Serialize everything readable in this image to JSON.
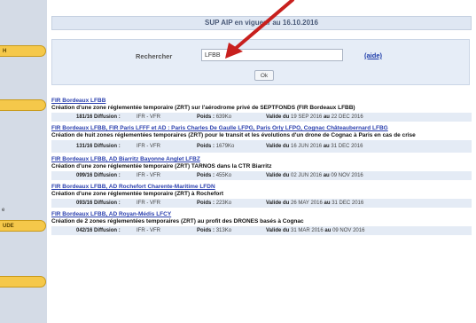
{
  "sidebar": {
    "buttons": [
      {
        "label": "H"
      },
      {
        "label": ""
      },
      {
        "label": "UDE"
      },
      {
        "label": ""
      }
    ],
    "text": "e"
  },
  "header": {
    "title": "SUP AIP en vigueur au 16.10.2016"
  },
  "search": {
    "label": "Rechercher",
    "value": "LFBB",
    "help": "(aide)",
    "ok": "Ok"
  },
  "entries": [
    {
      "title": "FIR Bordeaux LFBB",
      "desc": "Création d'une zone réglementée temporaire (ZRT) sur l'aérodrome privé de SEPTFONDS (FIR Bordeaux LFBB)",
      "number": "181/16",
      "diffusion_label": "Diffusion :",
      "diffusion": "IFR - VFR",
      "poids_label": "Poids :",
      "poids": "639Ko",
      "valid_label": "Valide du",
      "valid_from": "19 SEP 2016",
      "au": "au",
      "valid_to": "22 DEC 2016"
    },
    {
      "title": "FIR Bordeaux LFBB, FIR Paris LFFF et AD : Paris Charles De Gaulle LFPG, Paris Orly LFPO, Cognac Châteaubernard LFBG",
      "desc": "Création de huit zones réglementées temporaires (ZRT) pour le transit et les évolutions d'un drone de Cognac à Paris en cas de crise",
      "number": "131/16",
      "diffusion_label": "Diffusion :",
      "diffusion": "IFR - VFR",
      "poids_label": "Poids :",
      "poids": "1679Ko",
      "valid_label": "Valide du",
      "valid_from": "16 JUN 2016",
      "au": "au",
      "valid_to": "31 DEC 2016"
    },
    {
      "title": "FIR Bordeaux LFBB, AD Biarritz Bayonne Anglet LFBZ",
      "desc": "Création d'une zone réglementée temporaire (ZRT) TARNOS dans la CTR Biarritz",
      "number": "099/16",
      "diffusion_label": "Diffusion :",
      "diffusion": "IFR - VFR",
      "poids_label": "Poids :",
      "poids": "455Ko",
      "valid_label": "Valide du",
      "valid_from": "02 JUN 2016",
      "au": "au",
      "valid_to": "09 NOV 2016"
    },
    {
      "title": "FIR Bordeaux LFBB, AD Rochefort Charente-Maritime LFDN",
      "desc": "Création d'une zone réglementée temporaire (ZRT) à Rochefort",
      "number": "093/16",
      "diffusion_label": "Diffusion :",
      "diffusion": "IFR - VFR",
      "poids_label": "Poids :",
      "poids": "223Ko",
      "valid_label": "Valide du",
      "valid_from": "26 MAY 2016",
      "au": "au",
      "valid_to": "31 DEC 2016"
    },
    {
      "title": "FIR Bordeaux LFBB, AD Royan-Médis LFCY",
      "desc": "Création de 2 zones réglementées temporaires (ZRT) au profit des DRONES basés à Cognac",
      "number": "042/16",
      "diffusion_label": "Diffusion :",
      "diffusion": "IFR - VFR",
      "poids_label": "Poids :",
      "poids": "313Ko",
      "valid_label": "Valide du",
      "valid_from": "31 MAR 2016",
      "au": "au",
      "valid_to": "09 NOV 2016"
    }
  ],
  "colors": {
    "link": "#2a3fae",
    "sidebar_button": "#f5c84a",
    "arrow": "#c8201e"
  }
}
